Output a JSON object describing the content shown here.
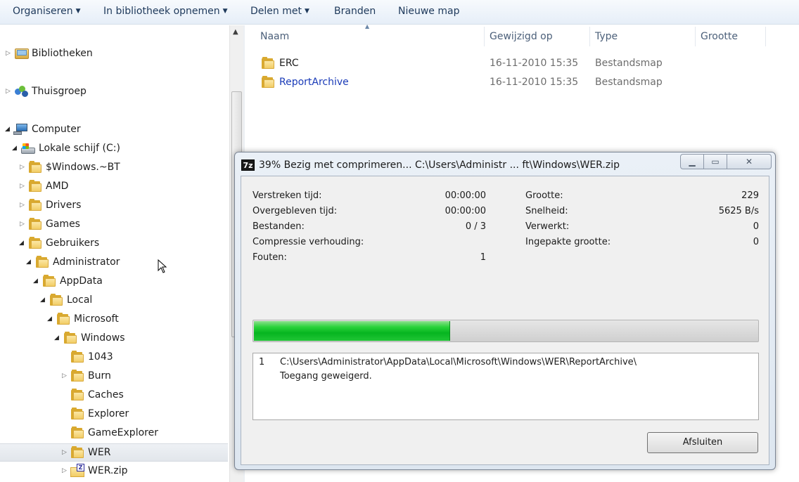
{
  "toolbar": {
    "organize": "Organiseren",
    "include_library": "In bibliotheek opnemen",
    "share_with": "Delen met",
    "burn": "Branden",
    "new_folder": "Nieuwe map"
  },
  "nav": {
    "libraries": "Bibliotheken",
    "homegroup": "Thuisgroep",
    "computer": "Computer",
    "local_disk": "Lokale schijf (C:)",
    "items": [
      {
        "label": "$Windows.~BT"
      },
      {
        "label": "AMD"
      },
      {
        "label": "Drivers"
      },
      {
        "label": "Games"
      },
      {
        "label": "Gebruikers"
      },
      {
        "label": "Administrator"
      },
      {
        "label": "AppData"
      },
      {
        "label": "Local"
      },
      {
        "label": "Microsoft"
      },
      {
        "label": "Windows"
      },
      {
        "label": "1043"
      },
      {
        "label": "Burn"
      },
      {
        "label": "Caches"
      },
      {
        "label": "Explorer"
      },
      {
        "label": "GameExplorer"
      },
      {
        "label": "WER"
      },
      {
        "label": "WER.zip"
      }
    ]
  },
  "columns": {
    "name": "Naam",
    "modified": "Gewijzigd op",
    "type": "Type",
    "size": "Grootte"
  },
  "files": [
    {
      "name": "ERC",
      "modified": "16-11-2010 15:35",
      "type": "Bestandsmap"
    },
    {
      "name": "ReportArchive",
      "modified": "16-11-2010 15:35",
      "type": "Bestandsmap"
    }
  ],
  "dialog": {
    "app_icon": "7z",
    "title": "39% Bezig met comprimeren... C:\\Users\\Administr ... ft\\Windows\\WER.zip",
    "elapsed_label": "Verstreken tijd:",
    "elapsed_value": "00:00:00",
    "remaining_label": "Overgebleven tijd:",
    "remaining_value": "00:00:00",
    "files_label": "Bestanden:",
    "files_value": "0 / 3",
    "ratio_label": "Compressie verhouding:",
    "ratio_value": "",
    "errors_label": "Fouten:",
    "errors_value": "1",
    "size_label": "Grootte:",
    "size_value": "229",
    "speed_label": "Snelheid:",
    "speed_value": "5625 B/s",
    "processed_label": "Verwerkt:",
    "processed_value": "0",
    "packed_label": "Ingepakte grootte:",
    "packed_value": "0",
    "progress_percent": 39,
    "log_number": "1",
    "log_path": "C:\\Users\\Administrator\\AppData\\Local\\Microsoft\\Windows\\WER\\ReportArchive\\",
    "log_message": "Toegang geweigerd.",
    "close_button": "Afsluiten"
  },
  "colors": {
    "progress_green": "#06b520",
    "link_blue": "#1a3bb8"
  }
}
